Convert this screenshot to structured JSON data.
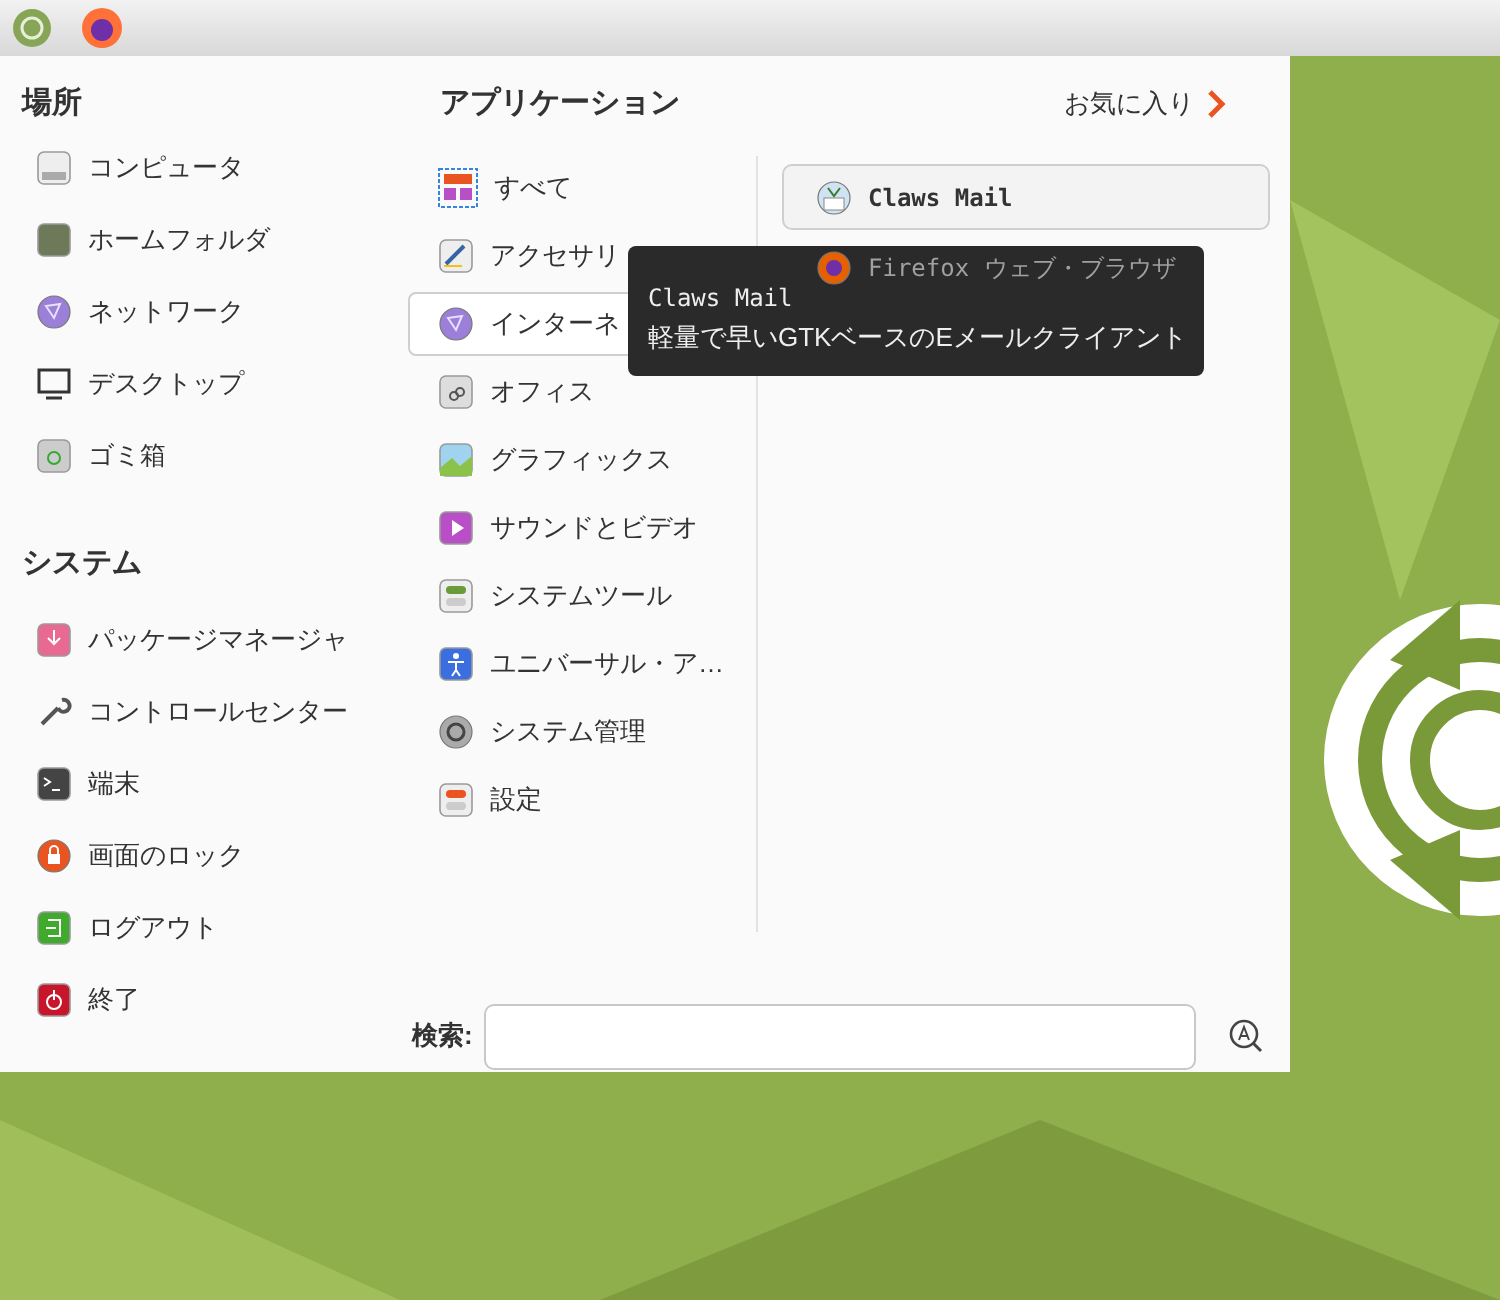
{
  "menu": {
    "places": {
      "heading": "場所",
      "items": [
        {
          "label": "コンピュータ"
        },
        {
          "label": "ホームフォルダ"
        },
        {
          "label": "ネットワーク"
        },
        {
          "label": "デスクトップ"
        },
        {
          "label": "ゴミ箱"
        }
      ]
    },
    "system": {
      "heading": "システム",
      "items": [
        {
          "label": "パッケージマネージャ"
        },
        {
          "label": "コントロールセンター"
        },
        {
          "label": "端末"
        },
        {
          "label": "画面のロック"
        },
        {
          "label": "ログアウト"
        },
        {
          "label": "終了"
        }
      ]
    },
    "applications": {
      "heading": "アプリケーション",
      "favorites_link": "お気に入り",
      "categories": [
        {
          "label": "すべて",
          "selected": false
        },
        {
          "label": "アクセサリ",
          "selected": false
        },
        {
          "label": "インターネ",
          "selected": true
        },
        {
          "label": "オフィス",
          "selected": false
        },
        {
          "label": "グラフィックス",
          "selected": false
        },
        {
          "label": "サウンドとビデオ",
          "selected": false
        },
        {
          "label": "システムツール",
          "selected": false
        },
        {
          "label": "ユニバーサル・ア…",
          "selected": false
        },
        {
          "label": "システム管理",
          "selected": false
        },
        {
          "label": "設定",
          "selected": false
        }
      ],
      "apps": [
        {
          "label": "Claws Mail",
          "selected": true
        },
        {
          "label": "Firefox ウェブ・ブラウザ",
          "selected": false
        }
      ]
    },
    "search": {
      "label": "検索:"
    }
  },
  "tooltip": {
    "title": "Claws Mail",
    "text": "軽量で早いGTKベースのEメールクライアント"
  }
}
